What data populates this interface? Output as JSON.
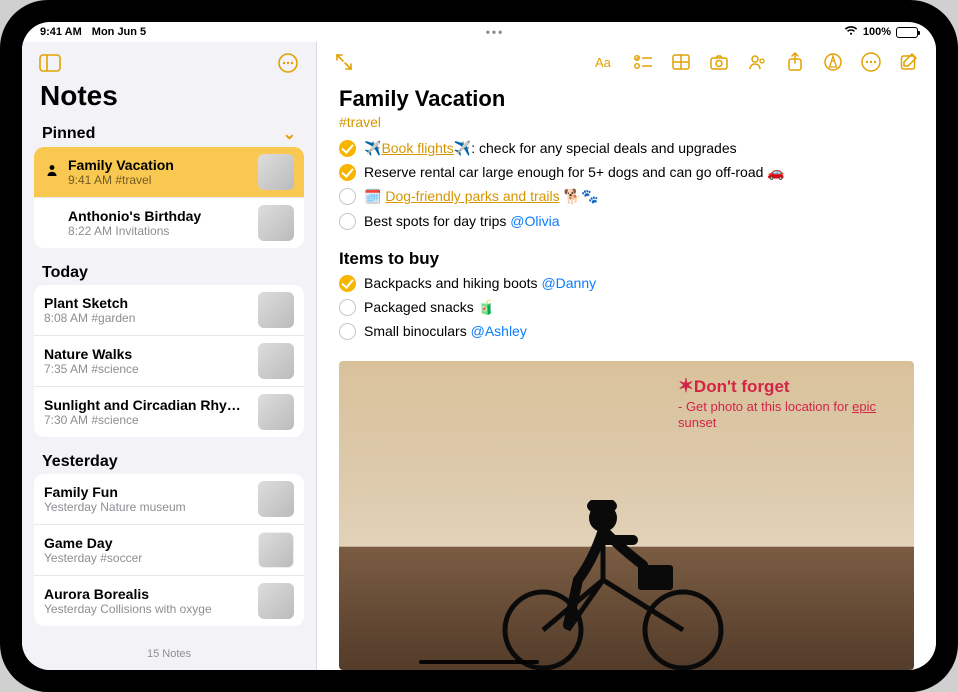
{
  "status": {
    "time": "9:41 AM",
    "date": "Mon Jun 5",
    "battery_pct": "100%"
  },
  "sidebar": {
    "title": "Notes",
    "footer": "15 Notes",
    "sections": [
      {
        "header": "Pinned",
        "items": [
          {
            "title": "Family Vacation",
            "meta": "9:41 AM  #travel",
            "thumb_class": "t-orange",
            "selected": true,
            "shared": true
          },
          {
            "title": "Anthonio's Birthday",
            "meta": "8:22 AM  Invitations",
            "thumb_class": "t-cake"
          }
        ]
      },
      {
        "header": "Today",
        "items": [
          {
            "title": "Plant Sketch",
            "meta": "8:08 AM  #garden",
            "thumb_class": "t-green"
          },
          {
            "title": "Nature Walks",
            "meta": "7:35 AM  #science",
            "thumb_class": "t-flowers"
          },
          {
            "title": "Sunlight and Circadian Rhy…",
            "meta": "7:30 AM  #science",
            "thumb_class": "t-purple"
          }
        ]
      },
      {
        "header": "Yesterday",
        "items": [
          {
            "title": "Family Fun",
            "meta": "Yesterday  Nature museum",
            "thumb_class": "t-grey"
          },
          {
            "title": "Game Day",
            "meta": "Yesterday  #soccer",
            "thumb_class": "t-white"
          },
          {
            "title": "Aurora Borealis",
            "meta": "Yesterday  Collisions with oxyge",
            "thumb_class": "t-purple"
          }
        ]
      }
    ]
  },
  "note": {
    "title": "Family Vacation",
    "tag": "#travel",
    "checklist1": {
      "items": [
        {
          "done": true,
          "pre": "✈️",
          "link": "Book flights",
          "post": "✈️: check for any special deals and upgrades"
        },
        {
          "done": true,
          "text": "Reserve rental car large enough for 5+ dogs and can go off-road 🚗"
        },
        {
          "done": false,
          "pre": "🗓️ ",
          "link": "Dog-friendly parks and trails",
          "post": " 🐕🐾"
        },
        {
          "done": false,
          "text_pre": "Best spots for day trips ",
          "mention": "@Olivia"
        }
      ]
    },
    "subheading": "Items to buy",
    "checklist2": {
      "items": [
        {
          "done": true,
          "text_pre": "Backpacks and hiking boots ",
          "mention": "@Danny"
        },
        {
          "done": false,
          "text": "Packaged snacks 🧃"
        },
        {
          "done": false,
          "text_pre": "Small binoculars ",
          "mention": "@Ashley"
        }
      ]
    },
    "handwriting": {
      "line1": "Don't forget",
      "line2_pre": "- Get photo at this location for ",
      "line2_em": "epic",
      "line2_post": " sunset"
    }
  }
}
